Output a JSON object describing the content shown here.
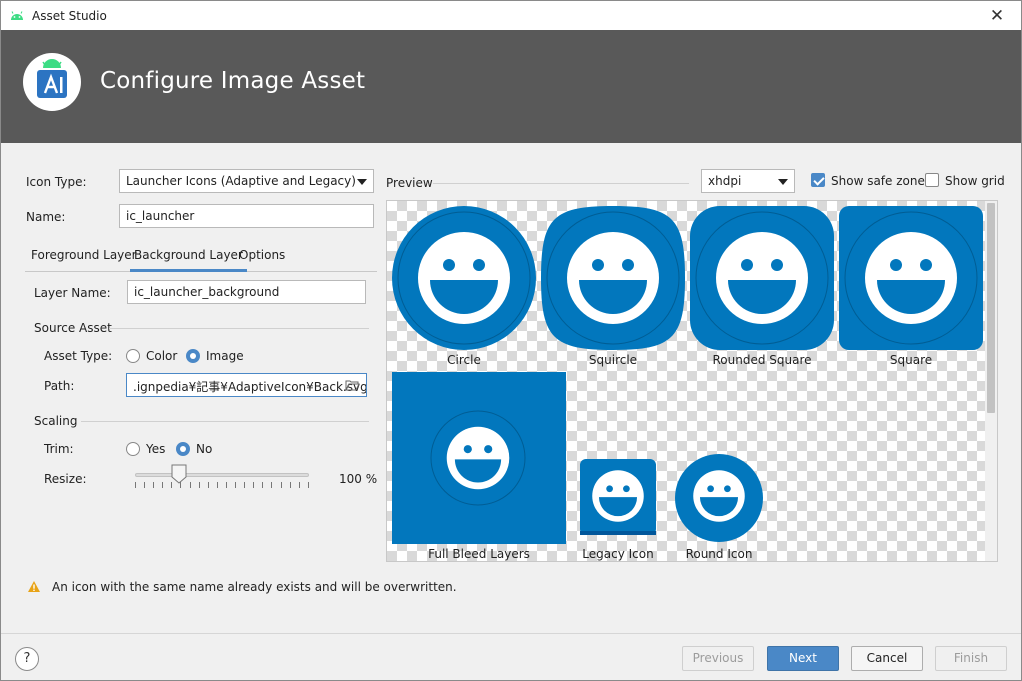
{
  "window": {
    "title": "Asset Studio",
    "close_glyph": "✕"
  },
  "banner": {
    "heading": "Configure Image Asset"
  },
  "form": {
    "icon_type_label": "Icon Type:",
    "icon_type_value": "Launcher Icons (Adaptive and Legacy)",
    "name_label": "Name:",
    "name_value": "ic_launcher"
  },
  "tabs": [
    {
      "label": "Foreground Layer",
      "active": false
    },
    {
      "label": "Background Layer",
      "active": true
    },
    {
      "label": "Options",
      "active": false
    }
  ],
  "layer": {
    "layer_name_label": "Layer Name:",
    "layer_name_value": "ic_launcher_background",
    "source_asset_title": "Source Asset",
    "asset_type_label": "Asset Type:",
    "asset_type_options": [
      "Color",
      "Image"
    ],
    "asset_type_selected": "Image",
    "path_label": "Path:",
    "path_value": ".ignpedia¥記事¥AdaptiveIcon¥Back.svg",
    "scaling_title": "Scaling",
    "trim_label": "Trim:",
    "trim_options": [
      "Yes",
      "No"
    ],
    "trim_selected": "No",
    "resize_label": "Resize:",
    "resize_value": "100 %"
  },
  "preview": {
    "label": "Preview",
    "density": "xhdpi",
    "show_safe_zone_label": "Show safe zone",
    "show_safe_zone_checked": true,
    "show_grid_label": "Show grid",
    "show_grid_checked": false,
    "icons": [
      "Circle",
      "Squircle",
      "Rounded Square",
      "Square",
      "Full Bleed Layers",
      "Legacy Icon",
      "Round Icon"
    ]
  },
  "warning": {
    "text": "An icon with the same name already exists and will be overwritten."
  },
  "footer": {
    "help": "?",
    "previous": "Previous",
    "next": "Next",
    "cancel": "Cancel",
    "finish": "Finish"
  },
  "colors": {
    "accent": "#4a88c7",
    "icon_blue": "#0277bd",
    "banner": "#595959"
  }
}
